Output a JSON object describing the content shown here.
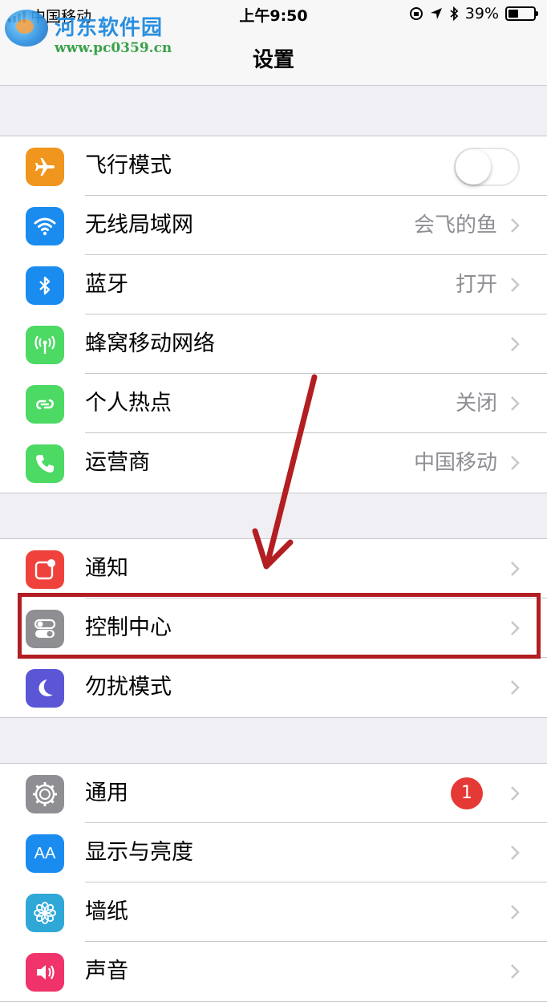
{
  "status_bar": {
    "carrier": "中国移动",
    "time": "上午9:50",
    "battery": "39%",
    "battery_level": 0.39
  },
  "nav": {
    "title": "设置"
  },
  "watermark": {
    "name": "河东软件园",
    "url": "www.pc0359.cn"
  },
  "groups": [
    {
      "rows": [
        {
          "label": "飞行模式",
          "icon": "airplane-icon",
          "color": "#f0961e",
          "toggle": true,
          "toggle_on": false
        },
        {
          "label": "无线局域网",
          "icon": "wifi-icon",
          "color": "#1a8cf0",
          "value": "会飞的鱼"
        },
        {
          "label": "蓝牙",
          "icon": "bluetooth-icon",
          "color": "#1a8cf0",
          "value": "打开"
        },
        {
          "label": "蜂窝移动网络",
          "icon": "antenna-icon",
          "color": "#4cd964",
          "value": ""
        },
        {
          "label": "个人热点",
          "icon": "hotspot-icon",
          "color": "#4cd964",
          "value": "关闭"
        },
        {
          "label": "运营商",
          "icon": "phone-icon",
          "color": "#4cd964",
          "value": "中国移动"
        }
      ]
    },
    {
      "rows": [
        {
          "label": "通知",
          "icon": "notifications-icon",
          "color": "#f0423c",
          "value": ""
        },
        {
          "label": "控制中心",
          "icon": "control-center-icon",
          "color": "#8e8e93",
          "value": ""
        },
        {
          "label": "勿扰模式",
          "icon": "moon-icon",
          "color": "#5b56d6",
          "value": ""
        }
      ]
    },
    {
      "rows": [
        {
          "label": "通用",
          "icon": "gear-icon",
          "color": "#8e8e93",
          "badge": "1"
        },
        {
          "label": "显示与亮度",
          "icon": "text-size-icon",
          "color": "#1a8cf0",
          "icon_text": "AA",
          "value": ""
        },
        {
          "label": "墙纸",
          "icon": "wallpaper-flower-icon",
          "color": "#2fa8d8",
          "value": ""
        },
        {
          "label": "声音",
          "icon": "speaker-icon",
          "color": "#f0336a",
          "value": ""
        }
      ]
    }
  ],
  "annotation": {
    "highlighted_row": "控制中心",
    "arrow_color": "#b21e22"
  }
}
